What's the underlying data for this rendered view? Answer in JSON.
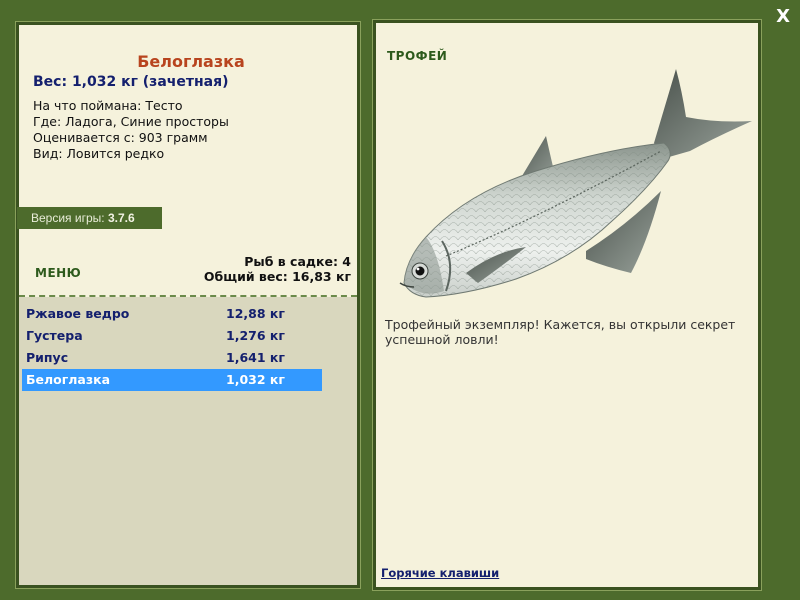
{
  "window": {
    "close_label": "X"
  },
  "fish": {
    "title": "Белоглазка",
    "weight_line": "Вес: 1,032 кг (зачетная)",
    "details": [
      "На что поймана: Тесто",
      "Где: Ладога, Синие просторы",
      "Оценивается с: 903 грамм",
      "Вид: Ловится редко"
    ]
  },
  "version": {
    "label": "Версия игры:",
    "value": "3.7.6"
  },
  "menu": {
    "label": "МЕНЮ"
  },
  "keep": {
    "count_line": "Рыб в садке: 4",
    "total_line": "Общий вес: 16,83 кг"
  },
  "catch_list": [
    {
      "name": "Ржавое ведро",
      "weight": "12,88 кг",
      "selected": false
    },
    {
      "name": "Густера",
      "weight": "1,276 кг",
      "selected": false
    },
    {
      "name": "Рипус",
      "weight": "1,641 кг",
      "selected": false
    },
    {
      "name": "Белоглазка",
      "weight": "1,032 кг",
      "selected": true
    }
  ],
  "trophy": {
    "label": "ТРОФЕЙ",
    "description": "Трофейный экземпляр! Кажется, вы открыли секрет успешной ловли!"
  },
  "footer": {
    "hotkeys_label": "Горячие клавиши"
  },
  "colors": {
    "frame": "#4d6b2c",
    "panel": "#f5f2dc",
    "list_bg": "#d9d7be",
    "selected": "#3399ff",
    "title": "#b8441e",
    "text_blue": "#14206e"
  }
}
